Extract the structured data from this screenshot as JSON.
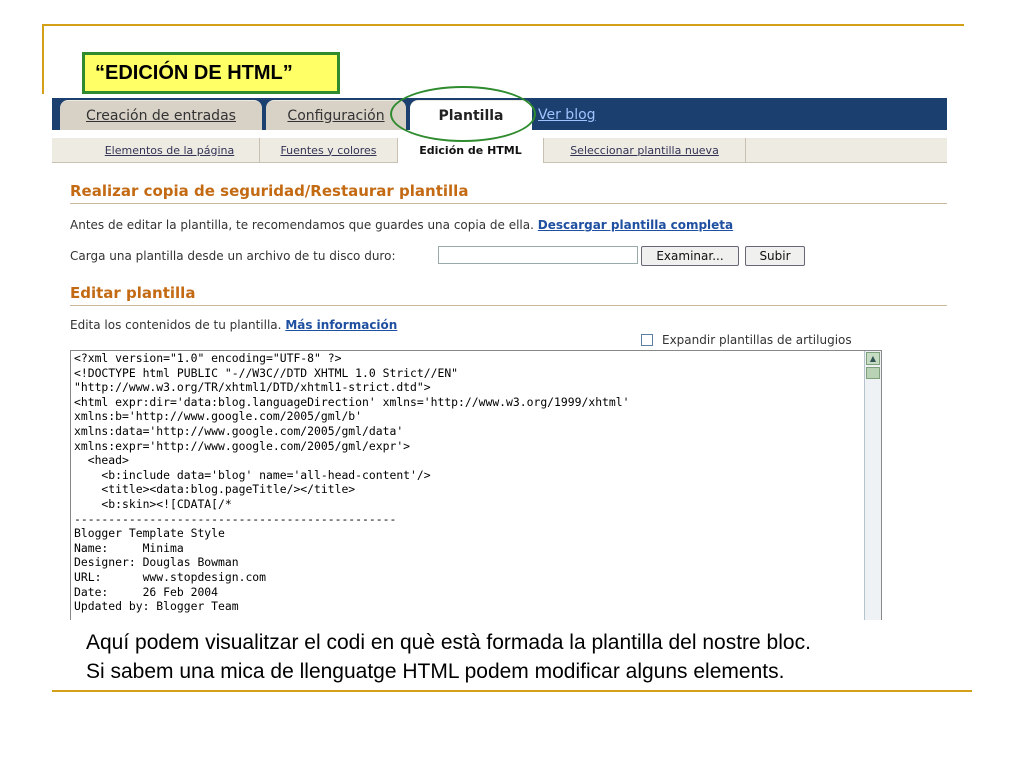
{
  "slide": {
    "title": "“EDICIÓN DE HTML”",
    "caption_line1": "Aquí podem visualitzar el codi en què està formada la plantilla del nostre bloc.",
    "caption_line2": "Si sabem una mica de llenguatge HTML podem modificar alguns elements."
  },
  "tabs": [
    {
      "label": "Creación de entradas"
    },
    {
      "label": "Configuración"
    },
    {
      "label": "Plantilla"
    },
    {
      "label": "Ver blog"
    }
  ],
  "subtabs": [
    {
      "label": "Elementos de la página"
    },
    {
      "label": "Fuentes y colores"
    },
    {
      "label": "Edición de HTML"
    },
    {
      "label": "Seleccionar plantilla nueva"
    }
  ],
  "backup": {
    "title": "Realizar copia de seguridad/Restaurar plantilla",
    "intro": "Antes de editar la plantilla, te recomendamos que guardes una copia de ella.",
    "download_link": "Descargar plantilla completa",
    "upload_label": "Carga una plantilla desde un archivo de tu disco duro:",
    "browse_button": "Examinar...",
    "upload_button": "Subir"
  },
  "editor": {
    "title": "Editar plantilla",
    "intro": "Edita los contenidos de tu plantilla.",
    "more_link": "Más información",
    "expand_label": "Expandir plantillas de artilugios",
    "code_lines": [
      "<?xml version=\"1.0\" encoding=\"UTF-8\" ?>",
      "<!DOCTYPE html PUBLIC \"-//W3C//DTD XHTML 1.0 Strict//EN\"",
      "\"http://www.w3.org/TR/xhtml1/DTD/xhtml1-strict.dtd\">",
      "<html expr:dir='data:blog.languageDirection' xmlns='http://www.w3.org/1999/xhtml'",
      "xmlns:b='http://www.google.com/2005/gml/b'",
      "xmlns:data='http://www.google.com/2005/gml/data'",
      "xmlns:expr='http://www.google.com/2005/gml/expr'>",
      "  <head>",
      "    <b:include data='blog' name='all-head-content'/>",
      "    <title><data:blog.pageTitle/></title>",
      "    <b:skin><![CDATA[/*",
      "-----------------------------------------------",
      "Blogger Template Style",
      "Name:     Minima",
      "Designer: Douglas Bowman",
      "URL:      www.stopdesign.com",
      "Date:     26 Feb 2004",
      "Updated by: Blogger Team"
    ]
  },
  "colors": {
    "accent_gold": "#d4a017",
    "title_box_bg": "#ffff66",
    "title_box_border": "#2e8b2e",
    "tabbar_bg": "#1b3f6e",
    "section_title": "#c36a13"
  }
}
